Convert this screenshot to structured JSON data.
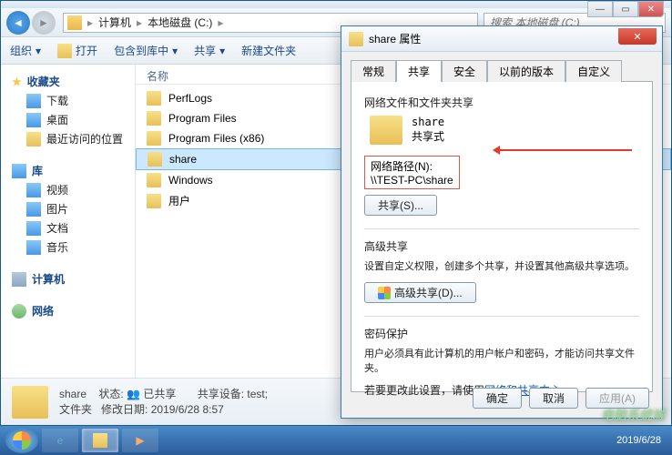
{
  "explorer": {
    "address": {
      "seg1": "计算机",
      "seg2": "本地磁盘 (C:)"
    },
    "search_placeholder": "搜索 本地磁盘 (C:)",
    "toolbar": {
      "org": "组织",
      "open": "打开",
      "include": "包含到库中",
      "share": "共享",
      "newfolder": "新建文件夹"
    },
    "sidebar": {
      "favorites": "收藏夹",
      "fav_items": [
        "下载",
        "桌面",
        "最近访问的位置"
      ],
      "libraries": "库",
      "lib_items": [
        "视频",
        "图片",
        "文档",
        "音乐"
      ],
      "computer": "计算机",
      "network": "网络"
    },
    "column_header": "名称",
    "files": [
      "PerfLogs",
      "Program Files",
      "Program Files (x86)",
      "share",
      "Windows",
      "用户"
    ],
    "selected_index": 3,
    "details": {
      "name": "share",
      "state_label": "状态:",
      "state_value": "已共享",
      "type_label": "文件夹",
      "mod_label": "修改日期:",
      "mod_value": "2019/6/28 8:57",
      "dev_label": "共享设备:",
      "dev_value": "test;"
    }
  },
  "properties": {
    "title": "share 属性",
    "tabs": [
      "常规",
      "共享",
      "安全",
      "以前的版本",
      "自定义"
    ],
    "active_tab": 1,
    "section1_title": "网络文件和文件夹共享",
    "share_name": "share",
    "share_mode": "共享式",
    "netpath_label": "网络路径(N):",
    "netpath_value": "\\\\TEST-PC\\share",
    "share_btn": "共享(S)...",
    "adv_title": "高级共享",
    "adv_body": "设置自定义权限，创建多个共享，并设置其他高级共享选项。",
    "adv_btn": "高级共享(D)...",
    "pw_title": "密码保护",
    "pw_body": "用户必须具有此计算机的用户帐户和密码，才能访问共享文件夹。",
    "pw_link_pre": "若要更改此设置，请使用",
    "pw_link": "网络和共享中心",
    "ok": "确定",
    "cancel": "取消",
    "apply": "应用(A)"
  },
  "taskbar": {
    "time": "2019/6/28"
  },
  "watermark": "电脑系统城"
}
